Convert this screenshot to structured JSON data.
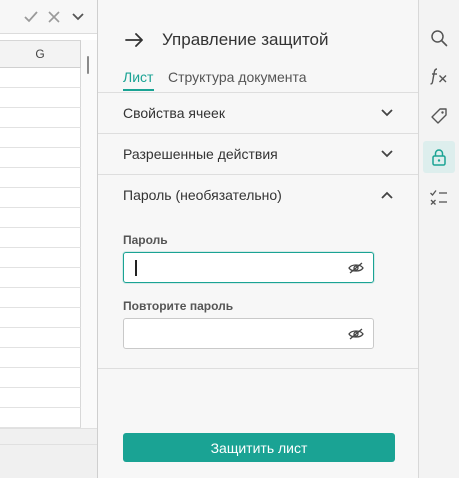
{
  "sheet": {
    "column_header": "G",
    "row_count": 18
  },
  "formula_bar": {
    "icons": [
      "check-icon",
      "close-icon",
      "chevron-down-icon"
    ]
  },
  "panel": {
    "title": "Управление защитой",
    "tabs": [
      {
        "label": "Лист",
        "active": true
      },
      {
        "label": "Структура документа",
        "active": false
      }
    ],
    "sections": [
      {
        "label": "Свойства ячеек",
        "expanded": false
      },
      {
        "label": "Разрешенные действия",
        "expanded": false
      },
      {
        "label": "Пароль (необязательно)",
        "expanded": true
      }
    ],
    "password": {
      "label": "Пароль",
      "value": "",
      "confirm_label": "Повторите пароль",
      "confirm_value": ""
    },
    "protect_button": "Защитить лист"
  },
  "rail": {
    "items": [
      {
        "icon": "search-icon",
        "active": false
      },
      {
        "icon": "function-icon",
        "active": false
      },
      {
        "icon": "tag-icon",
        "active": false
      },
      {
        "icon": "lock-icon",
        "active": true
      },
      {
        "icon": "checklist-icon",
        "active": false
      }
    ]
  },
  "colors": {
    "accent": "#1aa394",
    "panel_bg": "#f7f7f7",
    "rail_active_bg": "#ddeeed"
  }
}
